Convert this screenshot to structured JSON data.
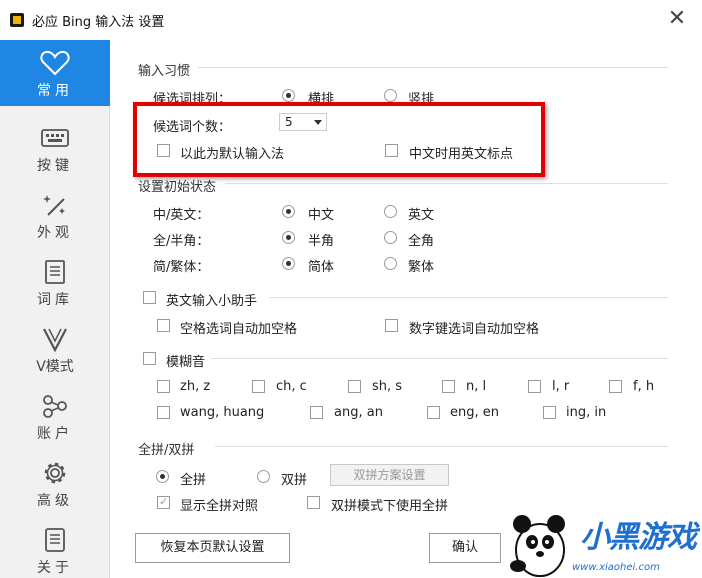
{
  "window": {
    "title": "必应 Bing 输入法 设置",
    "close": "✕"
  },
  "sidebar": {
    "items": [
      {
        "label": "常用",
        "icon": "heart-icon",
        "active": true
      },
      {
        "label": "按键",
        "icon": "keyboard-icon"
      },
      {
        "label": "外观",
        "icon": "magic-wand-icon"
      },
      {
        "label": "词库",
        "icon": "book-icon"
      },
      {
        "label": "V模式",
        "icon": "v-mode-icon"
      },
      {
        "label": "账户",
        "icon": "account-share-icon"
      },
      {
        "label": "高级",
        "icon": "gear-icon"
      },
      {
        "label": "关于",
        "icon": "document-icon"
      }
    ]
  },
  "habits": {
    "title": "输入习惯",
    "candidate_layout_label": "候选词排列：",
    "horizontal": "横排",
    "vertical": "竖排",
    "candidate_count_label": "候选词个数：",
    "candidate_count_value": "5",
    "default_ime": "以此为默认输入法",
    "english_punct": "中文时用英文标点"
  },
  "initial": {
    "title": "设置初始状态",
    "cn_en_label": "中/英文：",
    "cn": "中文",
    "en": "英文",
    "width_label": "全/半角：",
    "half": "半角",
    "full": "全角",
    "script_label": "简/繁体：",
    "simplified": "简体",
    "traditional": "繁体"
  },
  "english_helper": {
    "title": "英文输入小助手",
    "space_select": "空格选词自动加空格",
    "number_select": "数字键选词自动加空格"
  },
  "fuzzy": {
    "title": "模糊音",
    "pairs": [
      "zh, z",
      "ch, c",
      "sh, s",
      "n, l",
      "l, r",
      "f, h",
      "wang, huang",
      "ang, an",
      "eng, en",
      "ing, in"
    ]
  },
  "pinyin": {
    "title": "全拼/双拼",
    "full": "全拼",
    "double": "双拼",
    "scheme_button": "双拼方案设置",
    "show_full": "显示全拼对照",
    "double_use_full": "双拼模式下使用全拼"
  },
  "footer": {
    "restore": "恢复本页默认设置",
    "ok": "确认"
  },
  "watermark": {
    "text": "小黑游戏",
    "url": "www.xiaohei.com"
  },
  "colors": {
    "accent": "#1f87e3",
    "highlight": "#e30000"
  }
}
